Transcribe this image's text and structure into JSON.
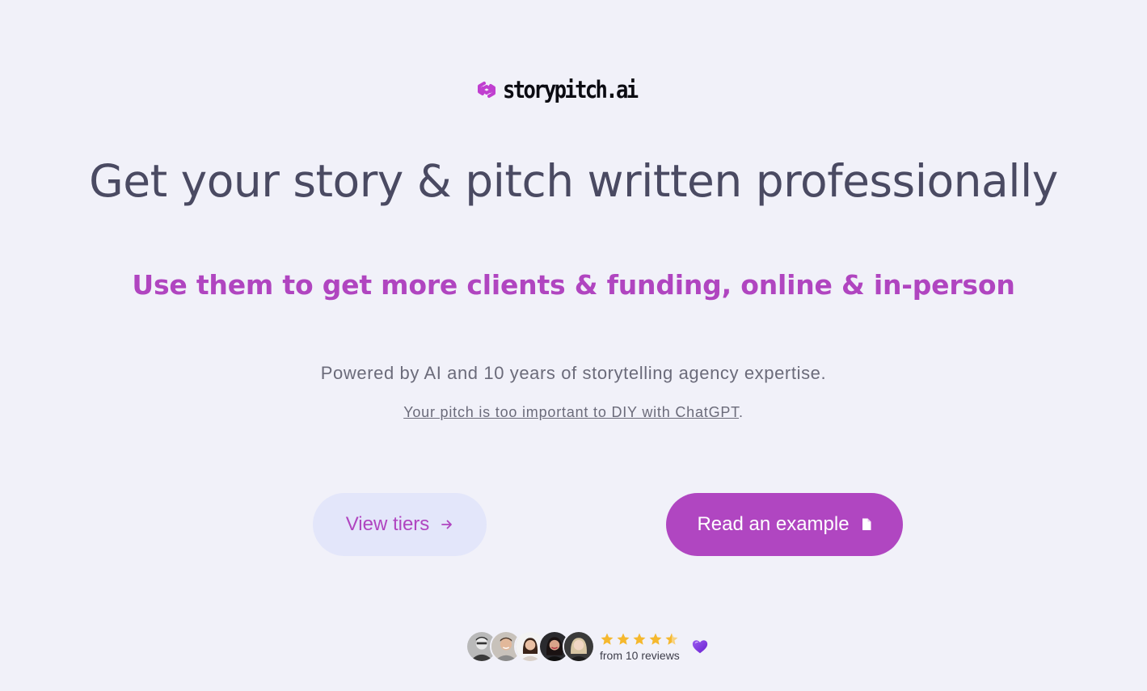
{
  "brand": {
    "name": "storypitch.ai",
    "logo_icon": "chain-link-icon",
    "accent_color": "#b046c1"
  },
  "hero": {
    "headline": "Get your story & pitch written professionally",
    "subheadline": "Use them to get more clients & funding, online & in-person",
    "powered_text": "Powered by AI and 10 years of storytelling agency expertise.",
    "diy_link": "Your pitch is too important to DIY with ChatGPT",
    "diy_suffix": "."
  },
  "buttons": {
    "view_tiers": {
      "label": "View tiers",
      "icon": "arrow-right-icon"
    },
    "read_example": {
      "label": "Read an example",
      "icon": "document-icon"
    }
  },
  "reviews": {
    "avatar_count": 5,
    "rating": 4.5,
    "max_rating": 5,
    "count_text": "from 10 reviews",
    "star_color": "#f5b82e",
    "heart_icon": "purple-heart-icon",
    "heart_color": "#7b2fe0"
  }
}
